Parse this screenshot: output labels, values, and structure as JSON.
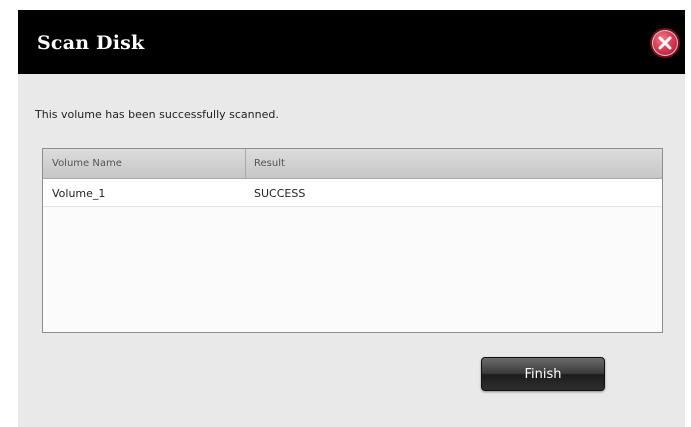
{
  "dialog": {
    "title": "Scan Disk",
    "message": "This volume has been successfully scanned."
  },
  "table": {
    "columns": [
      "Volume Name",
      "Result"
    ],
    "rows": [
      [
        "Volume_1",
        "SUCCESS"
      ]
    ]
  },
  "buttons": {
    "finish_label": "Finish",
    "close_icon": "close-icon"
  },
  "colors": {
    "title_bar": "#000000",
    "dialog_bg": "#e9e9e9",
    "close_red": "#d93a52",
    "button_dark": "#2e2e2e"
  }
}
